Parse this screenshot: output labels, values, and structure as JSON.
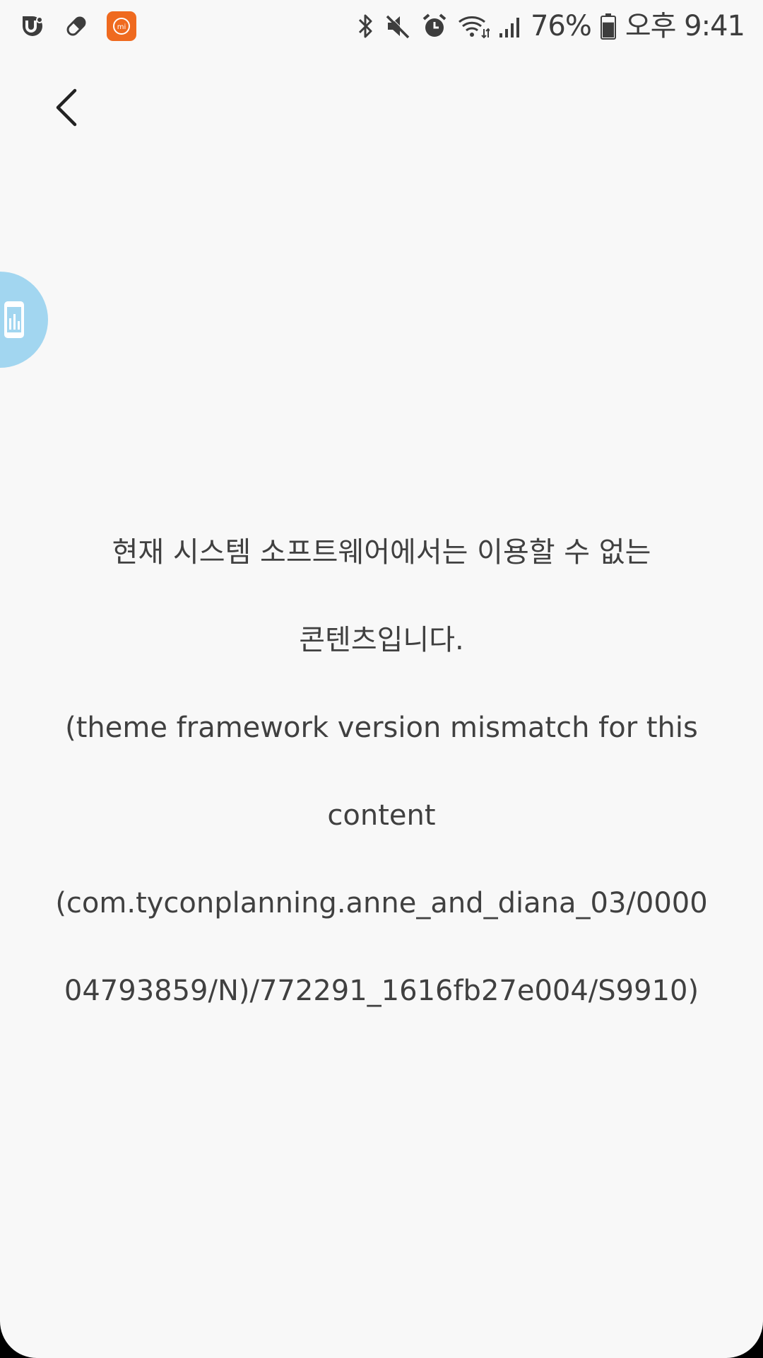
{
  "status_bar": {
    "left_icons": [
      "u-plus-icon",
      "pill-icon",
      "mi-fit-icon"
    ],
    "right_icons": [
      "bluetooth-icon",
      "mute-icon",
      "alarm-icon",
      "wifi-icon",
      "signal-icon"
    ],
    "battery_percent": "76%",
    "battery_level": 0.76,
    "time": "오후 9:41"
  },
  "app_bar": {
    "back_icon": "chevron-left-icon"
  },
  "floating_badge": {
    "icon": "tablet-chart-icon",
    "color": "#a2d6f0"
  },
  "message": {
    "korean_line1": "현재 시스템 소프트웨어에서는 이용할 수 없는",
    "korean_line2": "콘텐츠입니다.",
    "english_line1": "(theme framework version mismatch for this",
    "english_line2": "content",
    "detail_line1": "(com.tyconplanning.anne_and_diana_03/0000",
    "detail_line2": "04793859/N)/772291_1616fb27e004/S9910)"
  },
  "colors": {
    "background": "#f8f8f8",
    "text": "#404040",
    "mi_orange": "#ef6a1f"
  }
}
